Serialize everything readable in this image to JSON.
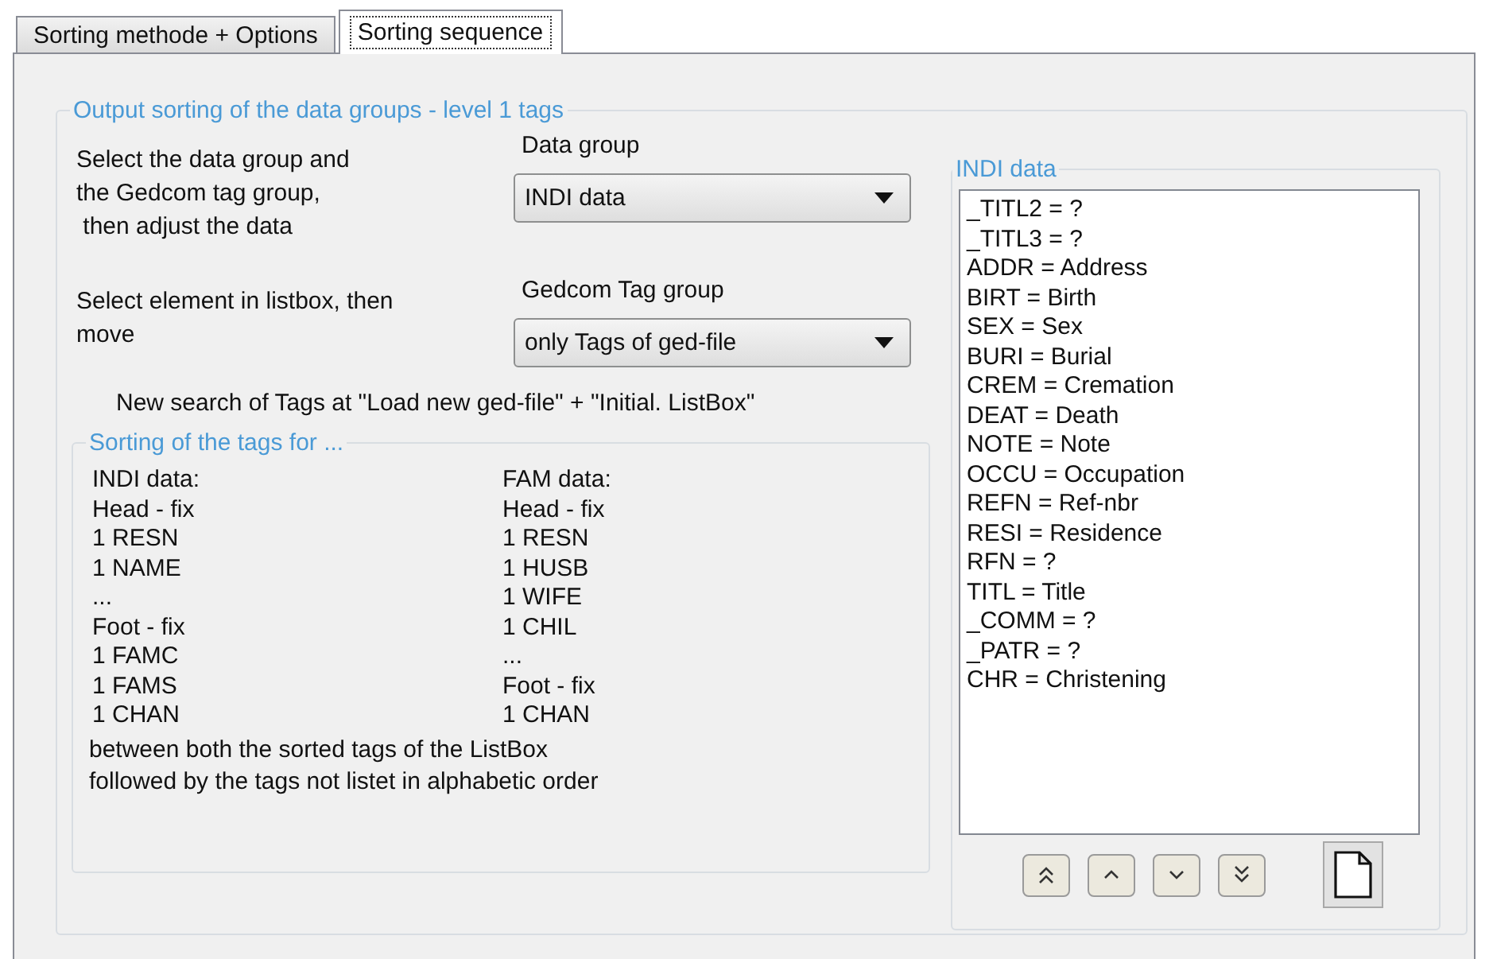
{
  "tabs": [
    {
      "label": "Sorting methode + Options",
      "selected": false
    },
    {
      "label": "Sorting sequence",
      "selected": true
    }
  ],
  "output_group": {
    "title": "Output sorting of the data groups - level 1 tags",
    "rows": [
      {
        "instruction": "Select the data group and\nthe Gedcom tag group,\n then adjust the data",
        "field": {
          "label": "Data group",
          "value": "INDI data"
        }
      },
      {
        "instruction": "Select element in listbox, then\nmove",
        "field": {
          "label": "Gedcom Tag group",
          "value": "only Tags of ged-file"
        }
      }
    ],
    "note": "New search of Tags at \"Load new ged-file\" + \"Initial. ListBox\"",
    "sorting_group": {
      "title": "Sorting of the tags for ...",
      "columns": [
        [
          "INDI data:",
          "Head - fix",
          "1 RESN",
          "1 NAME",
          "...",
          "Foot - fix",
          "1 FAMC",
          "1 FAMS",
          "1 CHAN"
        ],
        [
          "FAM data:",
          "Head - fix",
          "1 RESN",
          "1 HUSB",
          "1 WIFE",
          "1 CHIL",
          "...",
          "Foot - fix",
          "1 CHAN"
        ]
      ],
      "footer": "between both the sorted tags of the ListBox\nfollowed by the tags not listet in alphabetic order"
    },
    "list_group": {
      "title": "INDI data",
      "items": [
        "_TITL2 = ?",
        "_TITL3 = ?",
        "ADDR = Address",
        "BIRT = Birth",
        "SEX = Sex",
        "BURI = Burial",
        "CREM = Cremation",
        "DEAT = Death",
        "NOTE = Note",
        "OCCU = Occupation",
        "REFN = Ref-nbr",
        "RESI = Residence",
        "RFN = ?",
        "TITL = Title",
        "_COMM = ?",
        "_PATR = ?",
        "CHR = Christening"
      ],
      "buttons": [
        {
          "kind": "top"
        },
        {
          "kind": "up"
        },
        {
          "kind": "down"
        },
        {
          "kind": "bottom"
        },
        {
          "kind": "page"
        }
      ]
    }
  }
}
